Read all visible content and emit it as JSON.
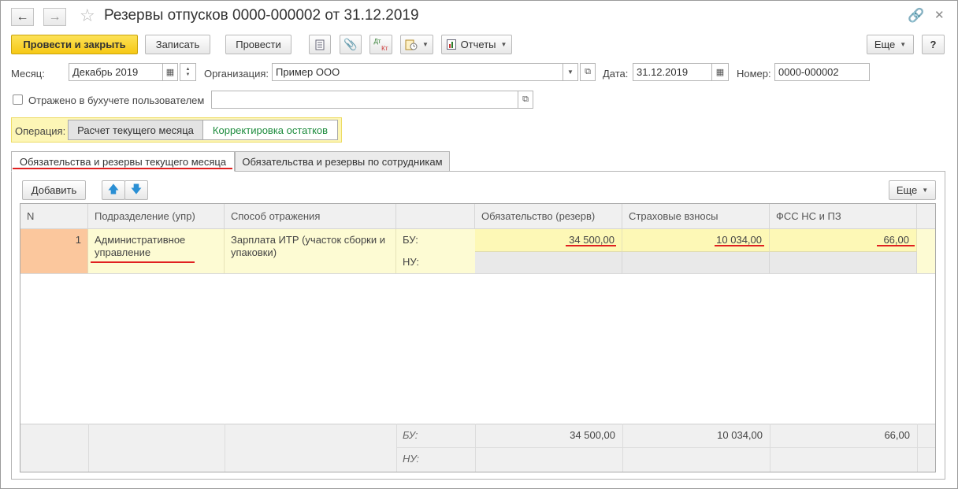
{
  "window": {
    "title": "Резервы отпусков 0000-000002 от 31.12.2019"
  },
  "toolbar": {
    "post_close_label": "Провести и закрыть",
    "save_label": "Записать",
    "post_label": "Провести",
    "reports_label": "Отчеты",
    "more_label": "Еще",
    "help_label": "?",
    "dtkt_top": "Дт",
    "dtkt_bottom": "Кт"
  },
  "form": {
    "month_label": "Месяц:",
    "month_value": "Декабрь 2019",
    "org_label": "Организация:",
    "org_value": "Пример ООО",
    "date_label": "Дата:",
    "date_value": "31.12.2019",
    "number_label": "Номер:",
    "number_value": "0000-000002",
    "reflected_label": "Отражено в бухучете пользователем",
    "reflected_value": ""
  },
  "operation": {
    "label": "Операция:",
    "options": [
      "Расчет текущего месяца",
      "Корректировка остатков"
    ],
    "selected": 0
  },
  "tabs": [
    {
      "label": "Обязательства и резервы текущего месяца",
      "active": true
    },
    {
      "label": "Обязательства и резервы по сотрудникам",
      "active": false
    }
  ],
  "table_toolbar": {
    "add_label": "Добавить",
    "more_label": "Еще"
  },
  "table": {
    "columns": [
      "N",
      "Подразделение (упр)",
      "Способ отражения",
      "",
      "Обязательство (резерв)",
      "Страховые взносы",
      "ФСС НС и ПЗ"
    ],
    "rows": [
      {
        "n": "1",
        "dept_line1": "Административное",
        "dept_line2": "управление",
        "method_line1": "Зарплата ИТР (участок сборки и",
        "method_line2": "упаковки)",
        "bu_label": "БУ:",
        "nu_label": "НУ:",
        "liability": "34 500,00",
        "insurance": "10 034,00",
        "fss": "66,00"
      }
    ],
    "footer": {
      "bu_label": "БУ:",
      "nu_label": "НУ:",
      "liability": "34 500,00",
      "insurance": "10 034,00",
      "fss": "66,00"
    }
  },
  "colors": {
    "primary_button": "#f6c815",
    "selected_row": "#fdfbd3",
    "selected_cell": "#fbc79d",
    "operation_bg": "#fdf6b6",
    "underline": "#e02020",
    "option_green": "#1c8b3c"
  },
  "icons": [
    "back-arrow-icon",
    "forward-arrow-icon",
    "favorite-star-icon",
    "link-icon",
    "close-icon",
    "document-list-icon",
    "paperclip-icon",
    "dtkt-icon",
    "create-based-on-icon",
    "reports-icon",
    "calendar-icon",
    "spin-icon",
    "open-icon",
    "move-up-icon",
    "move-down-icon"
  ]
}
